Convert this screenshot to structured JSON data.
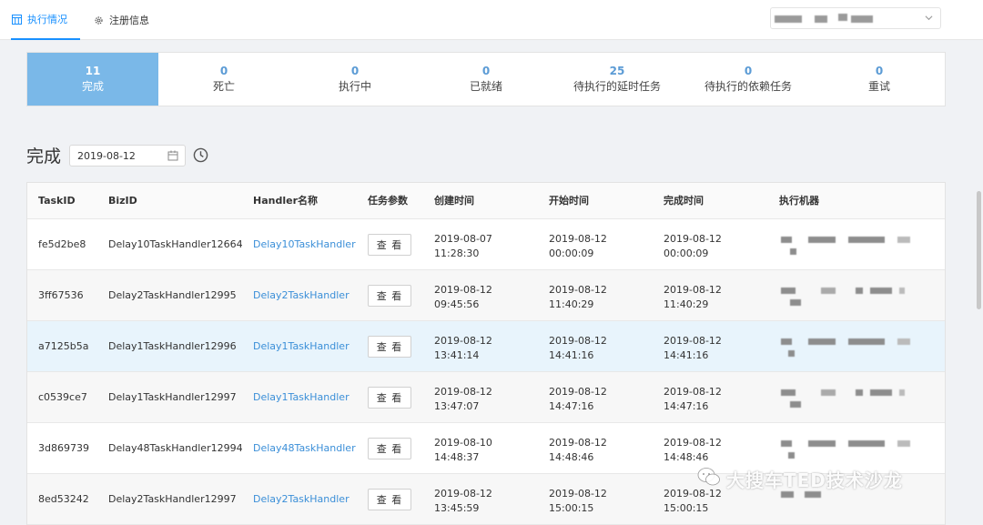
{
  "nav": {
    "tabs": [
      {
        "label": "执行情况",
        "icon": "grid-icon",
        "active": true
      },
      {
        "label": "注册信息",
        "icon": "gear-icon",
        "active": false
      }
    ]
  },
  "stats": [
    {
      "count": "11",
      "label": "完成",
      "active": true
    },
    {
      "count": "0",
      "label": "死亡"
    },
    {
      "count": "0",
      "label": "执行中"
    },
    {
      "count": "0",
      "label": "已就绪"
    },
    {
      "count": "25",
      "label": "待执行的延时任务"
    },
    {
      "count": "0",
      "label": "待执行的依赖任务"
    },
    {
      "count": "0",
      "label": "重试"
    }
  ],
  "section": {
    "title": "完成",
    "date": "2019-08-12"
  },
  "table": {
    "headers": [
      "TaskID",
      "BizID",
      "Handler名称",
      "任务参数",
      "创建时间",
      "开始时间",
      "完成时间",
      "执行机器"
    ],
    "view_label": "查 看",
    "rows": [
      {
        "task_id": "fe5d2be8",
        "biz_id": "Delay10TaskHandler12664",
        "handler": "Delay10TaskHandler",
        "created": [
          "2019-08-07",
          "11:28:30"
        ],
        "started": [
          "2019-08-12",
          "00:00:09"
        ],
        "finished": [
          "2019-08-12",
          "00:00:09"
        ]
      },
      {
        "task_id": "3ff67536",
        "biz_id": "Delay2TaskHandler12995",
        "handler": "Delay2TaskHandler",
        "created": [
          "2019-08-12",
          "09:45:56"
        ],
        "started": [
          "2019-08-12",
          "11:40:29"
        ],
        "finished": [
          "2019-08-12",
          "11:40:29"
        ]
      },
      {
        "task_id": "a7125b5a",
        "biz_id": "Delay1TaskHandler12996",
        "handler": "Delay1TaskHandler",
        "created": [
          "2019-08-12",
          "13:41:14"
        ],
        "started": [
          "2019-08-12",
          "14:41:16"
        ],
        "finished": [
          "2019-08-12",
          "14:41:16"
        ]
      },
      {
        "task_id": "c0539ce7",
        "biz_id": "Delay1TaskHandler12997",
        "handler": "Delay1TaskHandler",
        "created": [
          "2019-08-12",
          "13:47:07"
        ],
        "started": [
          "2019-08-12",
          "14:47:16"
        ],
        "finished": [
          "2019-08-12",
          "14:47:16"
        ]
      },
      {
        "task_id": "3d869739",
        "biz_id": "Delay48TaskHandler12994",
        "handler": "Delay48TaskHandler",
        "created": [
          "2019-08-10",
          "14:48:37"
        ],
        "started": [
          "2019-08-12",
          "14:48:46"
        ],
        "finished": [
          "2019-08-12",
          "14:48:46"
        ]
      },
      {
        "task_id": "8ed53242",
        "biz_id": "Delay2TaskHandler12997",
        "handler": "Delay2TaskHandler",
        "created": [
          "2019-08-12",
          "13:45:59"
        ],
        "started": [
          "2019-08-12",
          "15:00:15"
        ],
        "finished": [
          "2019-08-12",
          "15:00:15"
        ]
      }
    ]
  },
  "watermark": "大搜车TED技术沙龙"
}
